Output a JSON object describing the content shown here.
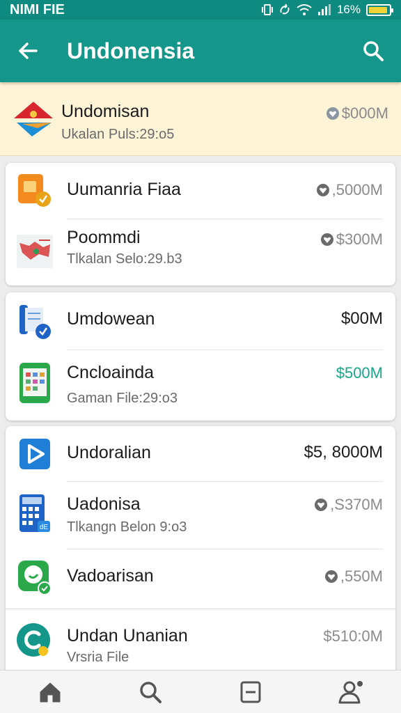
{
  "status_bar": {
    "carrier": "NIMI FIE",
    "battery": "16%"
  },
  "app_bar": {
    "title": "Undonensia"
  },
  "highlighted": {
    "name": "Undomisan",
    "subtitle": "Ukalan Puls:29:o5",
    "price": "$000M"
  },
  "card1": [
    {
      "name": "Uumanria Fiaa",
      "price": ",5000M"
    },
    {
      "name": "Poommdi",
      "subtitle": "Tlkalan Selo:29.b3",
      "price": "$300M"
    }
  ],
  "card2": [
    {
      "name": "Umdowean",
      "price": "$00M"
    },
    {
      "name": "Cncloainda",
      "subtitle": "Gaman File:29:o3",
      "price": "$500M"
    }
  ],
  "card3": [
    {
      "name": "Undoralian",
      "price": "$5, 8000M"
    },
    {
      "name": "Uadonisa",
      "subtitle": "Tlkangn Belon 9:o3",
      "price": ",S370M"
    },
    {
      "name": "Vadoarisan",
      "price": ",550M"
    },
    {
      "name": "Undan Unanian",
      "subtitle": "Vrsria File",
      "price": "$510:0M"
    }
  ],
  "colors": {
    "header": "#14968a",
    "status_bar": "#0f8a80",
    "highlight": "#fdf4d8",
    "accent_green": "#1aa58a"
  },
  "icons": [
    "back-arrow-icon",
    "search-icon",
    "home-icon",
    "search-nav-icon",
    "document-icon",
    "profile-icon"
  ]
}
